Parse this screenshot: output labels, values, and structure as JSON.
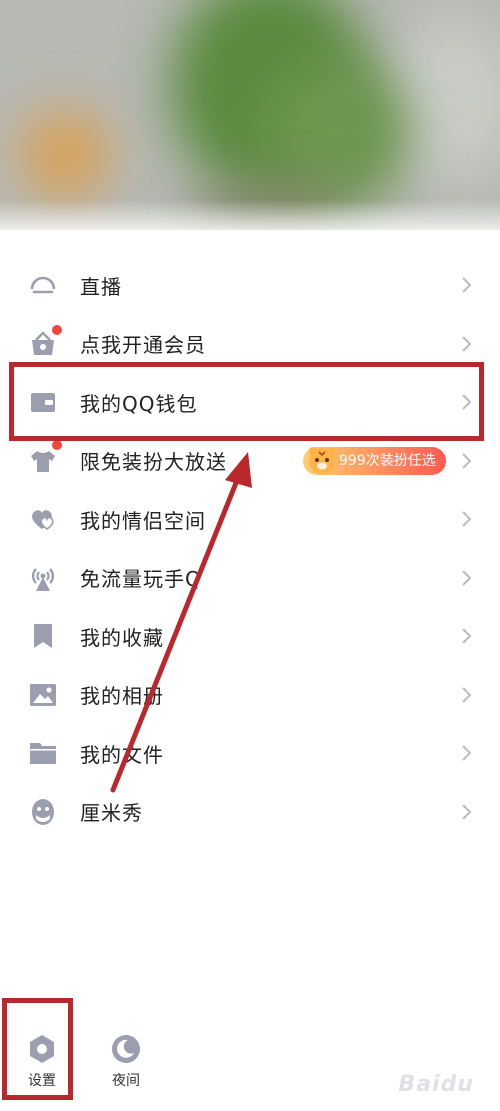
{
  "menu": {
    "items": [
      {
        "label": "直播",
        "icon": "live-icon"
      },
      {
        "label": "点我开通会员",
        "icon": "vip-shop-icon"
      },
      {
        "label": "我的QQ钱包",
        "icon": "wallet-icon"
      },
      {
        "label": "限免装扮大放送",
        "icon": "dress-up-shirt-icon"
      },
      {
        "label": "我的情侣空间",
        "icon": "couple-heart-icon"
      },
      {
        "label": "免流量玩手Q",
        "icon": "antenna-icon"
      },
      {
        "label": "我的收藏",
        "icon": "bookmark-icon"
      },
      {
        "label": "我的相册",
        "icon": "photo-album-icon"
      },
      {
        "label": "我的文件",
        "icon": "folder-icon"
      },
      {
        "label": "厘米秀",
        "icon": "cmshow-avatar-icon"
      }
    ]
  },
  "promo": {
    "badge_text": "999次装扮任选"
  },
  "bottom": {
    "settings_label": "设置",
    "night_label": "夜间"
  },
  "watermark": {
    "text": "Baidu"
  },
  "colors": {
    "icon_gray": "#9a9eaf",
    "annotation_red": "#b8282c",
    "badge_red": "#f0463c",
    "text": "#222222"
  }
}
